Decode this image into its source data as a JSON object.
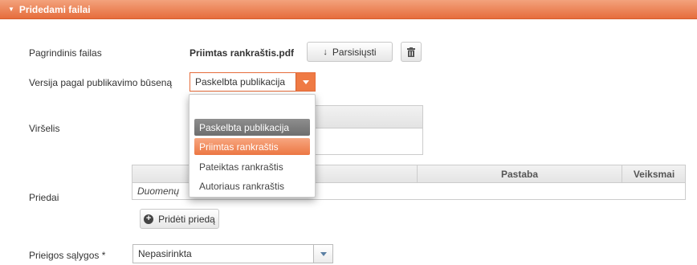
{
  "panel": {
    "title": "Pridedami failai"
  },
  "main_file": {
    "label": "Pagrindinis failas",
    "filename": "Priimtas rankraštis.pdf",
    "download_label": "Parsisiųsti"
  },
  "version": {
    "label": "Versija pagal publikavimo būseną",
    "selected": "Paskelbta publikacija",
    "options": [
      "Paskelbta publikacija",
      "Priimtas rankraštis",
      "Pateiktas rankraštis",
      "Autoriaus rankraštis"
    ]
  },
  "cover": {
    "label": "Viršelis"
  },
  "attachments": {
    "label": "Priedai",
    "columns": [
      "",
      "Pastaba",
      "Veiksmai"
    ],
    "empty_text": "Duomenų",
    "add_label": "Pridėti priedą"
  },
  "access": {
    "label": "Prieigos sąlygos *",
    "selected": "Nepasirinkta"
  },
  "colors": {
    "accent": "#e66d3c"
  },
  "icons": {
    "panel": "triangle-down-icon",
    "download": "download-arrow-icon",
    "delete": "trash-icon",
    "add": "plus-circle-icon"
  }
}
